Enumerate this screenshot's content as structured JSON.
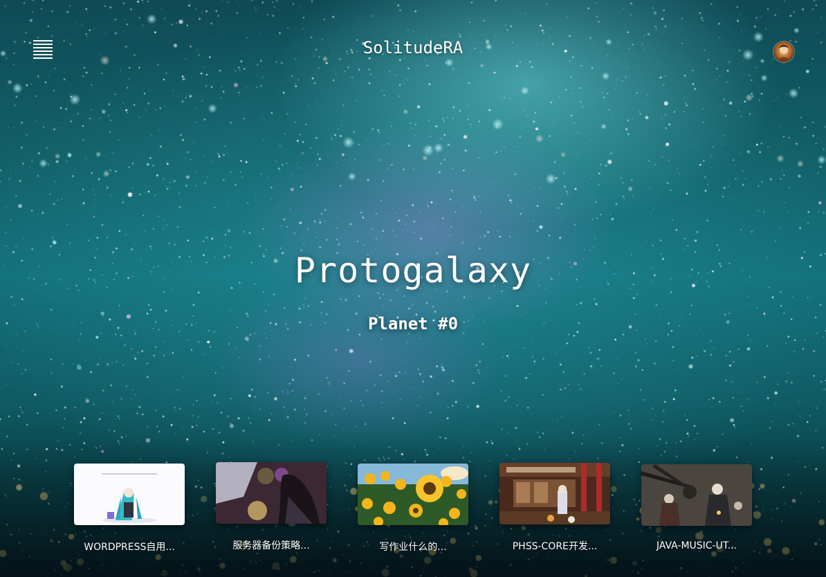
{
  "header": {
    "site_title": "SolitudeRA",
    "menu_icon": "hamburger-menu-icon",
    "avatar_icon": "user-avatar"
  },
  "hero": {
    "title": "Protogalaxy",
    "subtitle": "Planet #0"
  },
  "posts": [
    {
      "title": "WORDPRESS自用...",
      "thumbnail": "anime-girl-white-background"
    },
    {
      "title": "服务器备份策略...",
      "thumbnail": "anime-girl-dark-dress"
    },
    {
      "title": "写作业什么的...",
      "thumbnail": "sunflower-field"
    },
    {
      "title": "PHSS-CORE开发...",
      "thumbnail": "shrine-shop-scene"
    },
    {
      "title": "JAVA-MUSIC-UT...",
      "thumbnail": "soldiers-battle-scene"
    }
  ],
  "colors": {
    "sky_top": "#0f4a55",
    "sky_mid": "#13707a",
    "nebula_teal": "#6ed7dc",
    "nebula_purple": "#be82dc",
    "text": "#ffffff"
  }
}
